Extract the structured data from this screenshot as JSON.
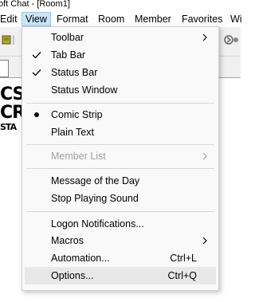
{
  "window": {
    "title": "oft Chat - [Room1]"
  },
  "menubar": {
    "items": [
      {
        "label": "Edit",
        "active": false
      },
      {
        "label": "View",
        "active": true
      },
      {
        "label": "Format",
        "active": false
      },
      {
        "label": "Room",
        "active": false
      },
      {
        "label": "Member",
        "active": false
      },
      {
        "label": "Favorites",
        "active": false
      },
      {
        "label": "Wi",
        "active": false
      }
    ]
  },
  "content": {
    "comic_line1": "CSh",
    "comic_line2": "CRE",
    "comic_line3": "STA"
  },
  "view_menu": {
    "items": [
      {
        "label": "Toolbar",
        "shortcut": "",
        "submenu": true,
        "checked": false,
        "radio": false,
        "disabled": false
      },
      {
        "label": "Tab Bar",
        "shortcut": "",
        "submenu": false,
        "checked": true,
        "radio": false,
        "disabled": false
      },
      {
        "label": "Status Bar",
        "shortcut": "",
        "submenu": false,
        "checked": true,
        "radio": false,
        "disabled": false
      },
      {
        "label": "Status Window",
        "shortcut": "",
        "submenu": false,
        "checked": false,
        "radio": false,
        "disabled": false
      },
      {
        "label": "Comic Strip",
        "shortcut": "",
        "submenu": false,
        "checked": false,
        "radio": true,
        "disabled": false
      },
      {
        "label": "Plain Text",
        "shortcut": "",
        "submenu": false,
        "checked": false,
        "radio": false,
        "disabled": false
      },
      {
        "label": "Member List",
        "shortcut": "",
        "submenu": true,
        "checked": false,
        "radio": false,
        "disabled": true
      },
      {
        "label": "Message of the Day",
        "shortcut": "",
        "submenu": false,
        "checked": false,
        "radio": false,
        "disabled": false
      },
      {
        "label": "Stop Playing Sound",
        "shortcut": "",
        "submenu": false,
        "checked": false,
        "radio": false,
        "disabled": false
      },
      {
        "label": "Logon Notifications...",
        "shortcut": "",
        "submenu": false,
        "checked": false,
        "radio": false,
        "disabled": false
      },
      {
        "label": "Macros",
        "shortcut": "",
        "submenu": true,
        "checked": false,
        "radio": false,
        "disabled": false
      },
      {
        "label": "Automation...",
        "shortcut": "Ctrl+L",
        "submenu": false,
        "checked": false,
        "radio": false,
        "disabled": false
      },
      {
        "label": "Options...",
        "shortcut": "Ctrl+Q",
        "submenu": false,
        "checked": false,
        "radio": false,
        "disabled": false,
        "hovered": true
      }
    ]
  },
  "icons": {
    "check": "checkmark-icon",
    "radio": "radio-dot-icon",
    "submenu": "chevron-right-icon"
  }
}
